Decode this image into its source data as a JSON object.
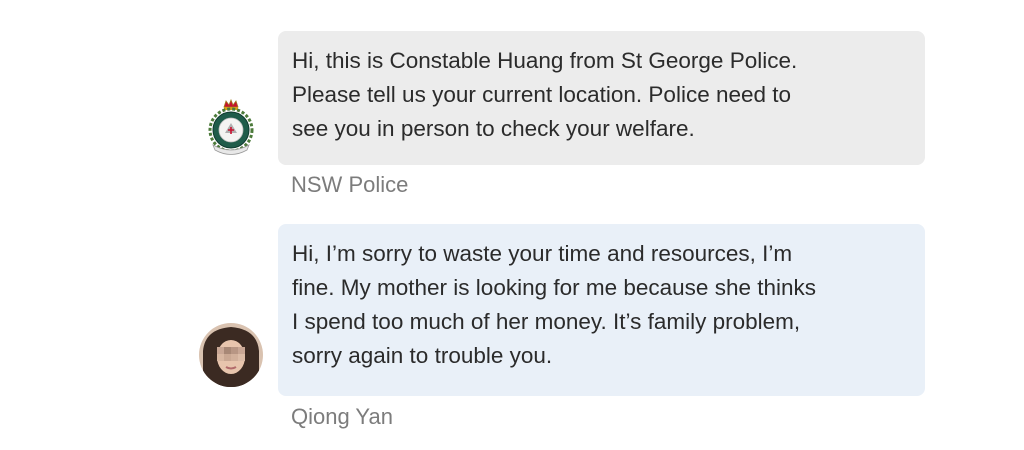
{
  "messages": [
    {
      "sender": "NSW Police",
      "text": "Hi, this is Constable Huang from St George Police.\nPlease tell us your current location. Police need to\nsee you in person to check your welfare.",
      "avatar_icon": "police-badge-icon",
      "bubble_color": "#ececec"
    },
    {
      "sender": "Qiong Yan",
      "text": "Hi, I’m sorry to waste your time and resources, I’m\nfine. My mother is looking for me because she thinks\nI spend too much of her money. It’s family problem,\nsorry again to trouble you.",
      "avatar_icon": "user-photo-avatar",
      "bubble_color": "#e9f0f8"
    }
  ]
}
